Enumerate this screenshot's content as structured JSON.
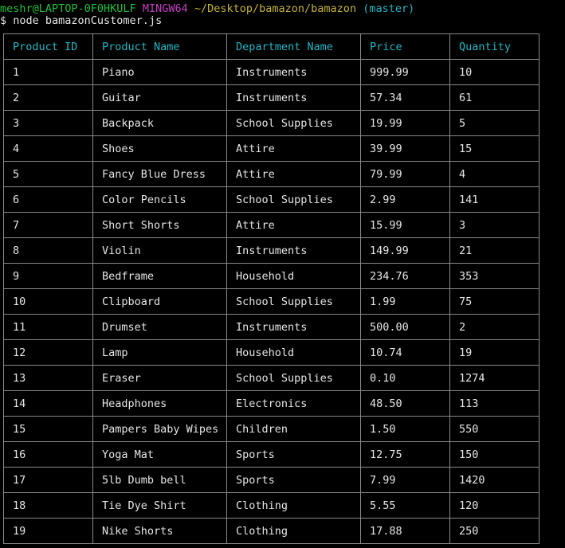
{
  "terminal": {
    "prompt": {
      "user_host": "meshr@LAPTOP-0F0HKULF",
      "env": "MINGW64",
      "path": "~/Desktop/bamazon/bamazon",
      "branch": "(master)"
    },
    "command": "$ node bamazonCustomer.js"
  },
  "table": {
    "headers": [
      "Product ID",
      "Product Name",
      "Department Name",
      "Price",
      "Quantity"
    ],
    "rows": [
      [
        "1",
        "Piano",
        "Instruments",
        "999.99",
        "10"
      ],
      [
        "2",
        "Guitar",
        "Instruments",
        "57.34",
        "61"
      ],
      [
        "3",
        "Backpack",
        "School Supplies",
        "19.99",
        "5"
      ],
      [
        "4",
        "Shoes",
        "Attire",
        "39.99",
        "15"
      ],
      [
        "5",
        "Fancy Blue Dress",
        "Attire",
        "79.99",
        "4"
      ],
      [
        "6",
        "Color Pencils",
        "School Supplies",
        "2.99",
        "141"
      ],
      [
        "7",
        "Short Shorts",
        "Attire",
        "15.99",
        "3"
      ],
      [
        "8",
        "Violin",
        "Instruments",
        "149.99",
        "21"
      ],
      [
        "9",
        "Bedframe",
        "Household",
        "234.76",
        "353"
      ],
      [
        "10",
        "Clipboard",
        "School Supplies",
        "1.99",
        "75"
      ],
      [
        "11",
        "Drumset",
        "Instruments",
        "500.00",
        "2"
      ],
      [
        "12",
        "Lamp",
        "Household",
        "10.74",
        "19"
      ],
      [
        "13",
        "Eraser",
        "School Supplies",
        "0.10",
        "1274"
      ],
      [
        "14",
        "Headphones",
        "Electronics",
        "48.50",
        "113"
      ],
      [
        "15",
        "Pampers Baby Wipes",
        "Children",
        "1.50",
        "550"
      ],
      [
        "16",
        "Yoga Mat",
        "Sports",
        "12.75",
        "150"
      ],
      [
        "17",
        "5lb Dumb bell",
        "Sports",
        "7.99",
        "1420"
      ],
      [
        "18",
        "Tie Dye Shirt",
        "Clothing",
        "5.55",
        "120"
      ],
      [
        "19",
        "Nike Shorts",
        "Clothing",
        "17.88",
        "250"
      ]
    ]
  },
  "colors": {
    "background": "#000000",
    "text": "#e6e6e6",
    "user_host": "#1fbf3f",
    "env": "#c23fc2",
    "path": "#c7b33a",
    "header_text": "#23b5c4",
    "border": "#8a8a8a"
  }
}
